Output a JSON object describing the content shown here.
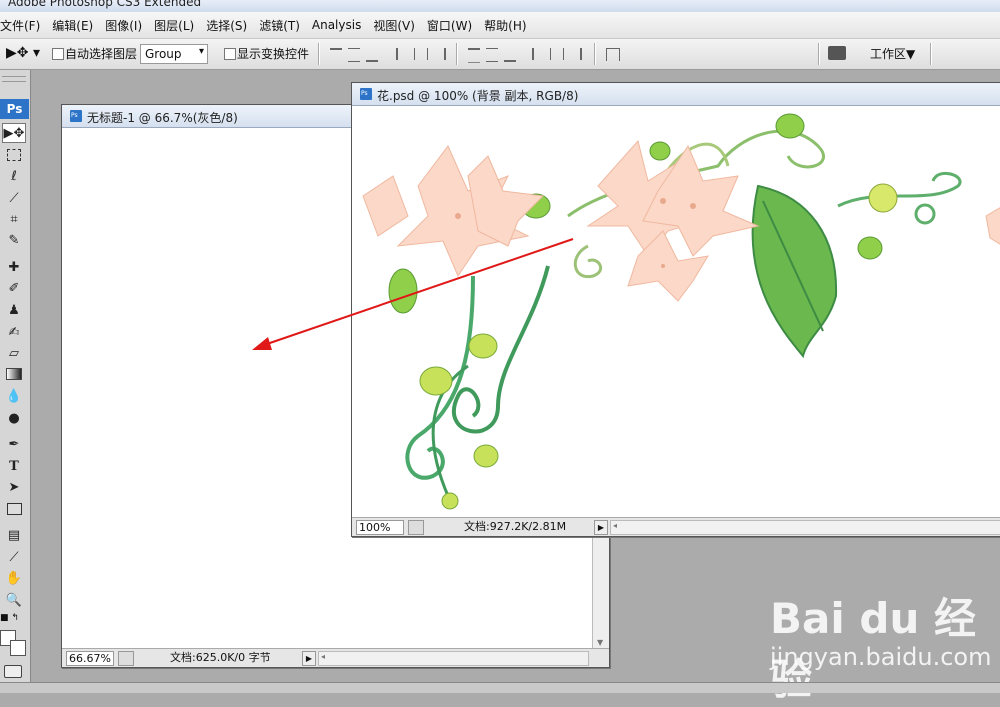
{
  "app": {
    "title": "Adobe Photoshop CS3 Extended"
  },
  "menu": [
    "文件(F)",
    "编辑(E)",
    "图像(I)",
    "图层(L)",
    "选择(S)",
    "滤镜(T)",
    "Analysis",
    "视图(V)",
    "窗口(W)",
    "帮助(H)"
  ],
  "options": {
    "auto_select_label": "自动选择图层",
    "auto_select_value": "Group",
    "show_transform_label": "显示变换控件",
    "workspace_label": "工作区▼"
  },
  "toolbox": {
    "logo": "Ps"
  },
  "doc_untitled": {
    "title": "无标题-1 @ 66.7%(灰色/8)",
    "zoom": "66.67%",
    "doc_info": "文档:625.0K/0 字节"
  },
  "doc_flower": {
    "title": "花.psd @ 100% (背景 副本, RGB/8)",
    "zoom": "100%",
    "doc_info": "文档:927.2K/2.81M"
  },
  "watermark": {
    "brand": "Bai du 经验",
    "url": "jingyan.baidu.com"
  },
  "colors": {
    "arrow": "#e01818",
    "ps_blue": "#2d74c9",
    "workspace_bg": "#ababab"
  },
  "icons": [
    "move-tool-icon",
    "marquee-tool-icon",
    "lasso-tool-icon",
    "magic-wand-icon",
    "crop-tool-icon",
    "slice-tool-icon",
    "healing-brush-icon",
    "brush-tool-icon",
    "clone-stamp-icon",
    "history-brush-icon",
    "eraser-icon",
    "gradient-icon",
    "blur-icon",
    "dodge-icon",
    "pen-tool-icon",
    "type-tool-icon",
    "path-select-icon",
    "shape-tool-icon",
    "notes-icon",
    "eyedropper-icon",
    "hand-tool-icon",
    "zoom-tool-icon"
  ]
}
